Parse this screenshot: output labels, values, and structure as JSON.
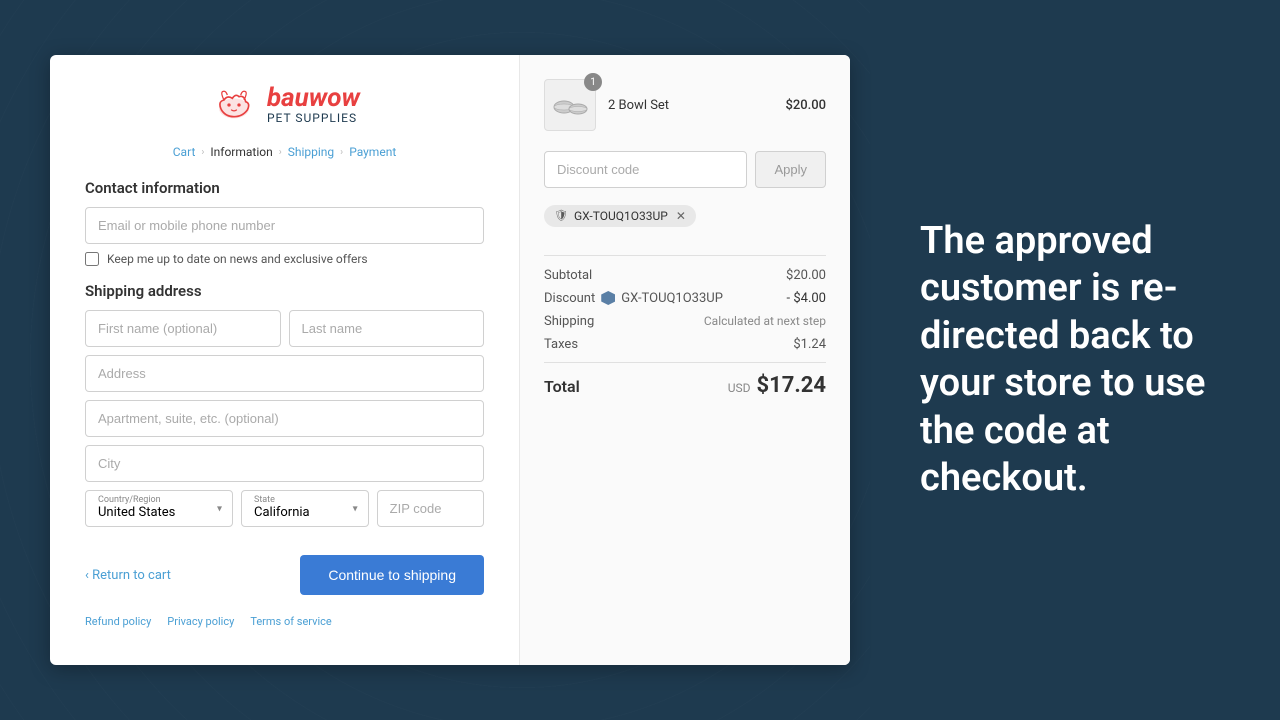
{
  "page": {
    "background_color": "#1e3a4f"
  },
  "logo": {
    "brand": "bauwow",
    "subtitle": "Pet Supplies"
  },
  "breadcrumb": {
    "items": [
      "Cart",
      "Information",
      "Shipping",
      "Payment"
    ],
    "active": "Information",
    "separator": "›"
  },
  "contact_section": {
    "title": "Contact information",
    "email_placeholder": "Email or mobile phone number",
    "checkbox_label": "Keep me up to date on news and exclusive offers"
  },
  "shipping_section": {
    "title": "Shipping address",
    "first_name_placeholder": "First name (optional)",
    "last_name_placeholder": "Last name",
    "address_placeholder": "Address",
    "apt_placeholder": "Apartment, suite, etc. (optional)",
    "city_placeholder": "City",
    "country_label": "Country/Region",
    "country_value": "United States",
    "state_label": "State",
    "state_value": "California",
    "zip_placeholder": "ZIP code"
  },
  "actions": {
    "return_label": "‹ Return to cart",
    "continue_label": "Continue to shipping"
  },
  "footer": {
    "links": [
      "Refund policy",
      "Privacy policy",
      "Terms of service"
    ]
  },
  "order_summary": {
    "item_name": "2 Bowl Set",
    "item_price": "$20.00",
    "item_quantity": "1",
    "discount_placeholder": "Discount code",
    "apply_label": "Apply",
    "coupon_code": "GX-TOUQ1O33UP",
    "subtotal_label": "Subtotal",
    "subtotal_value": "$20.00",
    "discount_label": "Discount",
    "discount_code_display": "GX-TOUQ1O33UP",
    "discount_value": "- $4.00",
    "shipping_label": "Shipping",
    "shipping_value": "Calculated at next step",
    "taxes_label": "Taxes",
    "taxes_value": "$1.24",
    "total_label": "Total",
    "total_currency": "USD",
    "total_value": "$17.24"
  },
  "right_panel": {
    "text": "The approved customer is re-directed back to your store to use the code at checkout."
  }
}
